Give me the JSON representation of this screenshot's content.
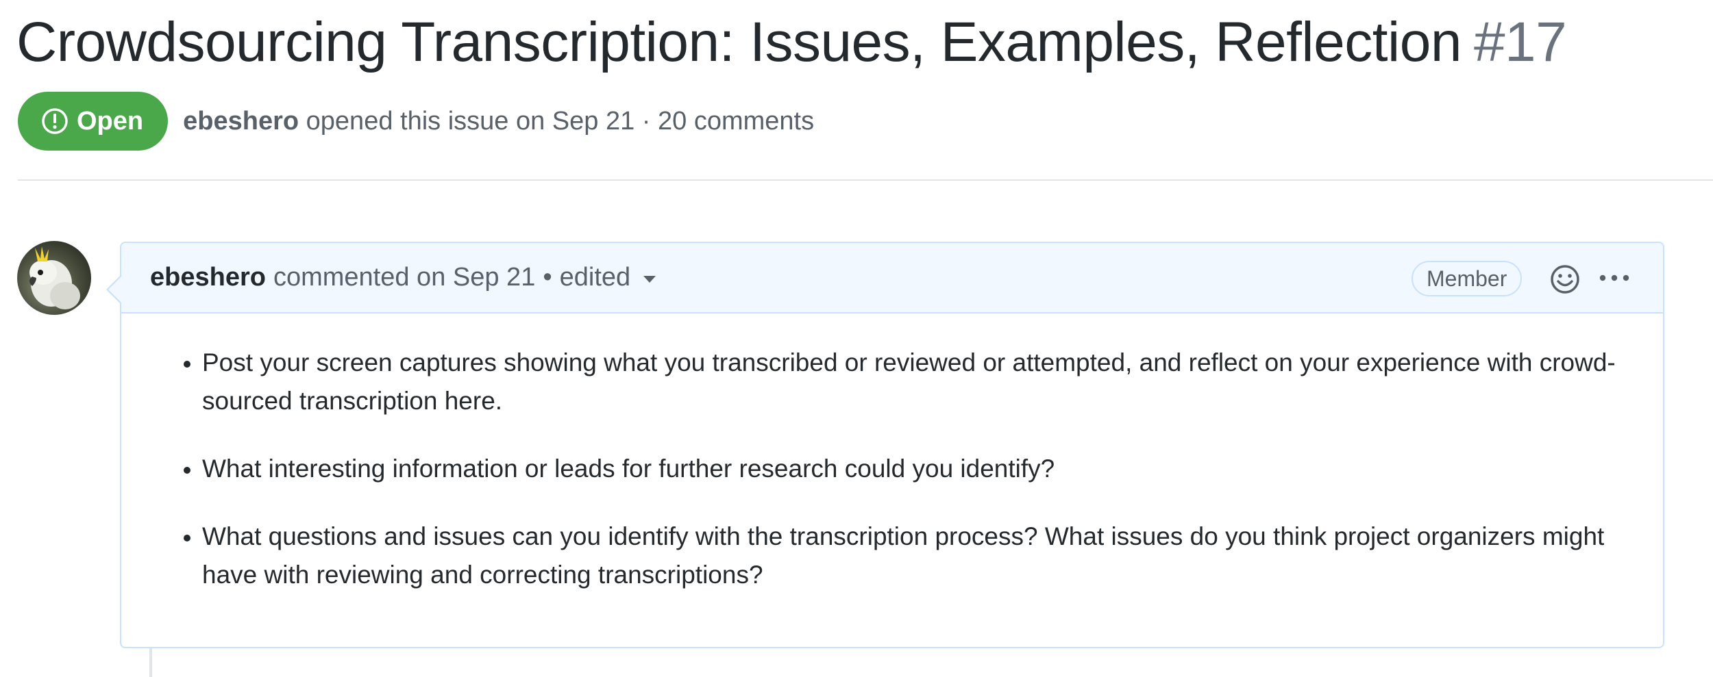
{
  "issue": {
    "title": "Crowdsourcing Transcription: Issues, Examples, Reflection",
    "number": "#17",
    "state": "Open",
    "author": "ebeshero",
    "meta_text": "opened this issue on Sep 21 · 20 comments"
  },
  "comment": {
    "author": "ebeshero",
    "action": "commented on Sep 21",
    "separator": "•",
    "edited_label": "edited",
    "author_association": "Member",
    "body_items": [
      "Post your screen captures showing what you transcribed or reviewed or attempted, and reflect on your experience with crowd-sourced transcription here.",
      "What interesting information or leads for further research could you identify?",
      "What questions and issues can you identify with the transcription process? What issues do you think project organizers might have with reviewing and correcting transcriptions?"
    ]
  },
  "colors": {
    "open_badge": "#4aa84a",
    "comment_border": "#c8e1ff",
    "comment_header_bg": "#f1f8ff",
    "muted_text": "#586069"
  },
  "icons": {
    "state": "issue-opened-icon",
    "dropdown": "triangle-down-icon",
    "reaction": "smiley-icon",
    "more": "kebab-horizontal-icon",
    "avatar": "cockatoo-avatar"
  }
}
